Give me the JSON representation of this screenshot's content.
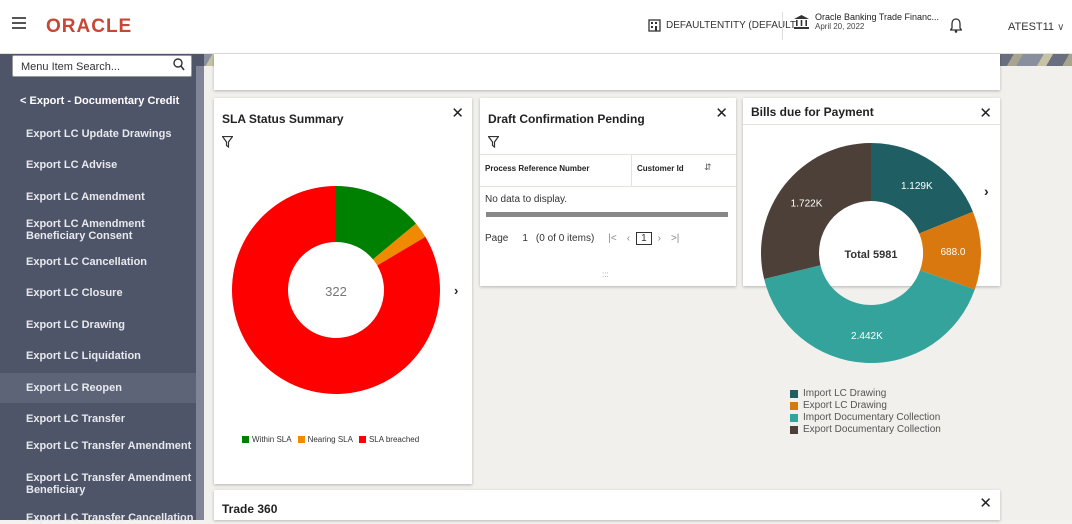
{
  "header": {
    "logo": "ORACLE",
    "entity": "DEFAULTENTITY (DEFAULT...",
    "bank_name": "Oracle Banking Trade Financ...",
    "bank_date": "April 20, 2022",
    "user": "ATEST11"
  },
  "sidebar": {
    "search_placeholder": "Menu Item Search...",
    "back_label": "Export - Documentary Credit",
    "items": [
      "Export LC Update Drawings",
      "Export LC Advise",
      "Export LC Amendment",
      "Export LC Amendment Beneficiary Consent",
      "Export LC Cancellation",
      "Export LC Closure",
      "Export LC Drawing",
      "Export LC Liquidation",
      "Export LC Reopen",
      "Export LC Transfer",
      "Export LC Transfer Amendment",
      "Export LC Transfer Amendment Beneficiary",
      "Export LC Transfer Cancellation"
    ],
    "active_index": 8
  },
  "sla": {
    "title": "SLA Status Summary",
    "center_value": "322",
    "legend": [
      "Within SLA",
      "Nearing SLA",
      "SLA breached"
    ],
    "colors": [
      "#008000",
      "#f08a00",
      "#ff0000"
    ]
  },
  "draft": {
    "title": "Draft Confirmation Pending",
    "columns": [
      "Process Reference Number",
      "Customer Id"
    ],
    "empty_text": "No data to display.",
    "page_label": "Page",
    "page_num": "1",
    "items_text": "(0 of 0 items)",
    "current_page": "1"
  },
  "bills": {
    "title": "Bills due for Payment",
    "total_label": "Total 5981",
    "legend": [
      "Import LC Drawing",
      "Export LC Drawing",
      "Import Documentary Collection",
      "Export Documentary Collection"
    ],
    "colors": [
      "#1f5e63",
      "#d9780f",
      "#33a39c",
      "#4d4038"
    ]
  },
  "trade": {
    "title": "Trade 360"
  },
  "chart_data": [
    {
      "type": "pie",
      "title": "SLA Status Summary",
      "categories": [
        "Within SLA",
        "Nearing SLA",
        "SLA breached"
      ],
      "values": [
        45,
        8,
        269
      ],
      "center_label": "322"
    },
    {
      "type": "pie",
      "title": "Bills due for Payment",
      "categories": [
        "Import LC Drawing",
        "Export LC Drawing",
        "Import Documentary Collection",
        "Export Documentary Collection"
      ],
      "values": [
        1129,
        688,
        2442,
        1722
      ],
      "data_labels": [
        "1.129K",
        "688.0",
        "2.442K",
        "1.722K"
      ],
      "center_label": "Total 5981"
    }
  ]
}
